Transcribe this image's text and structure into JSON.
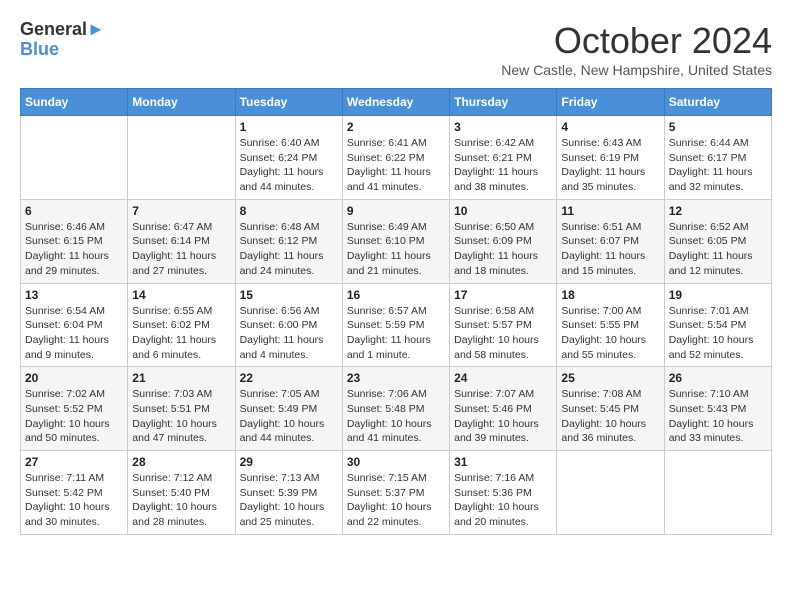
{
  "header": {
    "logo_line1": "General",
    "logo_line2": "Blue",
    "month_title": "October 2024",
    "location": "New Castle, New Hampshire, United States"
  },
  "weekdays": [
    "Sunday",
    "Monday",
    "Tuesday",
    "Wednesday",
    "Thursday",
    "Friday",
    "Saturday"
  ],
  "weeks": [
    [
      {
        "day": "",
        "info": ""
      },
      {
        "day": "",
        "info": ""
      },
      {
        "day": "1",
        "info": "Sunrise: 6:40 AM\nSunset: 6:24 PM\nDaylight: 11 hours and 44 minutes."
      },
      {
        "day": "2",
        "info": "Sunrise: 6:41 AM\nSunset: 6:22 PM\nDaylight: 11 hours and 41 minutes."
      },
      {
        "day": "3",
        "info": "Sunrise: 6:42 AM\nSunset: 6:21 PM\nDaylight: 11 hours and 38 minutes."
      },
      {
        "day": "4",
        "info": "Sunrise: 6:43 AM\nSunset: 6:19 PM\nDaylight: 11 hours and 35 minutes."
      },
      {
        "day": "5",
        "info": "Sunrise: 6:44 AM\nSunset: 6:17 PM\nDaylight: 11 hours and 32 minutes."
      }
    ],
    [
      {
        "day": "6",
        "info": "Sunrise: 6:46 AM\nSunset: 6:15 PM\nDaylight: 11 hours and 29 minutes."
      },
      {
        "day": "7",
        "info": "Sunrise: 6:47 AM\nSunset: 6:14 PM\nDaylight: 11 hours and 27 minutes."
      },
      {
        "day": "8",
        "info": "Sunrise: 6:48 AM\nSunset: 6:12 PM\nDaylight: 11 hours and 24 minutes."
      },
      {
        "day": "9",
        "info": "Sunrise: 6:49 AM\nSunset: 6:10 PM\nDaylight: 11 hours and 21 minutes."
      },
      {
        "day": "10",
        "info": "Sunrise: 6:50 AM\nSunset: 6:09 PM\nDaylight: 11 hours and 18 minutes."
      },
      {
        "day": "11",
        "info": "Sunrise: 6:51 AM\nSunset: 6:07 PM\nDaylight: 11 hours and 15 minutes."
      },
      {
        "day": "12",
        "info": "Sunrise: 6:52 AM\nSunset: 6:05 PM\nDaylight: 11 hours and 12 minutes."
      }
    ],
    [
      {
        "day": "13",
        "info": "Sunrise: 6:54 AM\nSunset: 6:04 PM\nDaylight: 11 hours and 9 minutes."
      },
      {
        "day": "14",
        "info": "Sunrise: 6:55 AM\nSunset: 6:02 PM\nDaylight: 11 hours and 6 minutes."
      },
      {
        "day": "15",
        "info": "Sunrise: 6:56 AM\nSunset: 6:00 PM\nDaylight: 11 hours and 4 minutes."
      },
      {
        "day": "16",
        "info": "Sunrise: 6:57 AM\nSunset: 5:59 PM\nDaylight: 11 hours and 1 minute."
      },
      {
        "day": "17",
        "info": "Sunrise: 6:58 AM\nSunset: 5:57 PM\nDaylight: 10 hours and 58 minutes."
      },
      {
        "day": "18",
        "info": "Sunrise: 7:00 AM\nSunset: 5:55 PM\nDaylight: 10 hours and 55 minutes."
      },
      {
        "day": "19",
        "info": "Sunrise: 7:01 AM\nSunset: 5:54 PM\nDaylight: 10 hours and 52 minutes."
      }
    ],
    [
      {
        "day": "20",
        "info": "Sunrise: 7:02 AM\nSunset: 5:52 PM\nDaylight: 10 hours and 50 minutes."
      },
      {
        "day": "21",
        "info": "Sunrise: 7:03 AM\nSunset: 5:51 PM\nDaylight: 10 hours and 47 minutes."
      },
      {
        "day": "22",
        "info": "Sunrise: 7:05 AM\nSunset: 5:49 PM\nDaylight: 10 hours and 44 minutes."
      },
      {
        "day": "23",
        "info": "Sunrise: 7:06 AM\nSunset: 5:48 PM\nDaylight: 10 hours and 41 minutes."
      },
      {
        "day": "24",
        "info": "Sunrise: 7:07 AM\nSunset: 5:46 PM\nDaylight: 10 hours and 39 minutes."
      },
      {
        "day": "25",
        "info": "Sunrise: 7:08 AM\nSunset: 5:45 PM\nDaylight: 10 hours and 36 minutes."
      },
      {
        "day": "26",
        "info": "Sunrise: 7:10 AM\nSunset: 5:43 PM\nDaylight: 10 hours and 33 minutes."
      }
    ],
    [
      {
        "day": "27",
        "info": "Sunrise: 7:11 AM\nSunset: 5:42 PM\nDaylight: 10 hours and 30 minutes."
      },
      {
        "day": "28",
        "info": "Sunrise: 7:12 AM\nSunset: 5:40 PM\nDaylight: 10 hours and 28 minutes."
      },
      {
        "day": "29",
        "info": "Sunrise: 7:13 AM\nSunset: 5:39 PM\nDaylight: 10 hours and 25 minutes."
      },
      {
        "day": "30",
        "info": "Sunrise: 7:15 AM\nSunset: 5:37 PM\nDaylight: 10 hours and 22 minutes."
      },
      {
        "day": "31",
        "info": "Sunrise: 7:16 AM\nSunset: 5:36 PM\nDaylight: 10 hours and 20 minutes."
      },
      {
        "day": "",
        "info": ""
      },
      {
        "day": "",
        "info": ""
      }
    ]
  ]
}
